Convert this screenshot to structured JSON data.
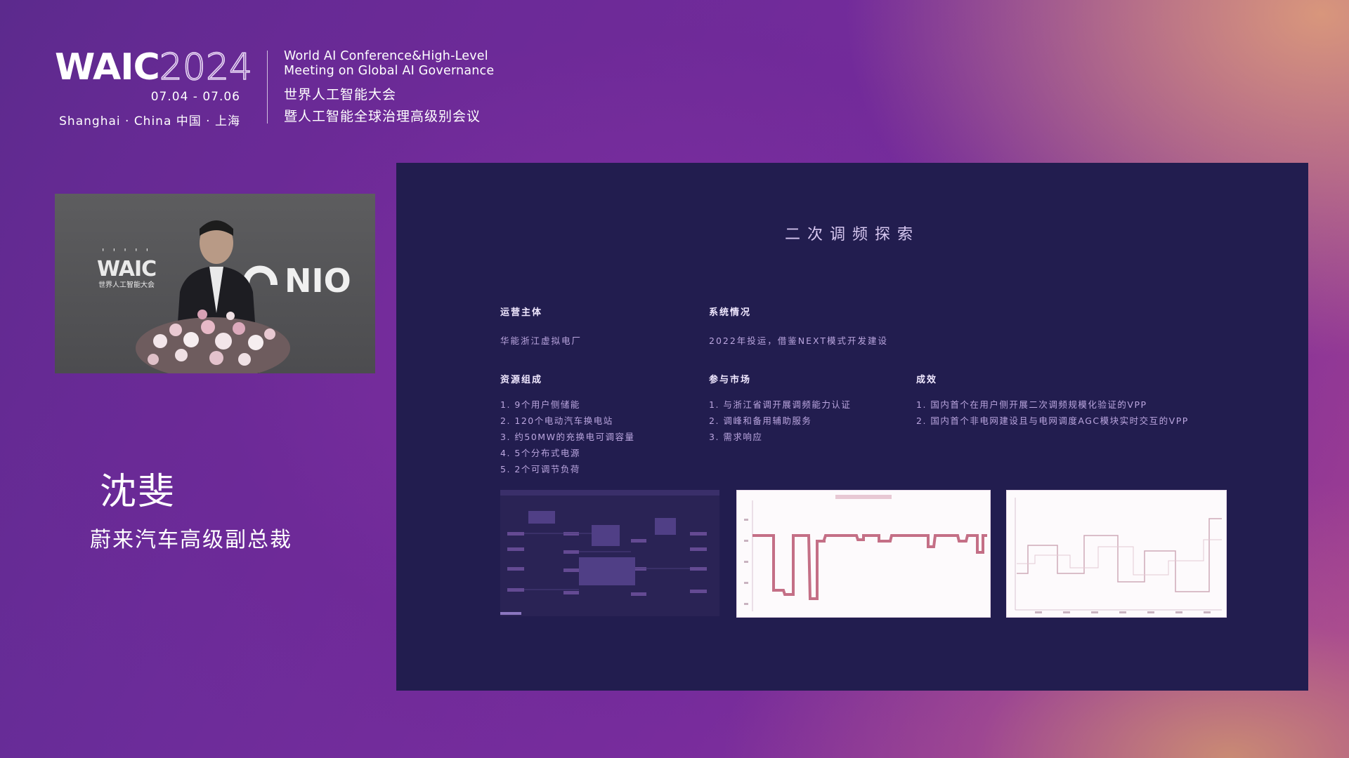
{
  "header": {
    "logo_word": "WAIC",
    "logo_year": "2024",
    "dates": "07.04 - 07.06",
    "location": "Shanghai · China  中国 · 上海",
    "title_en_line1": "World AI Conference&High-Level",
    "title_en_line2": "Meeting on Global AI Governance",
    "title_cn_line1": "世界人工智能大会",
    "title_cn_line2": "暨人工智能全球治理高级别会议"
  },
  "video": {
    "backdrop_logo_word": "WAIC",
    "backdrop_logo_sub": "世界人工智能大会",
    "backdrop_brand": "NIO"
  },
  "speaker": {
    "name": "沈斐",
    "title": "蔚来汽车高级副总裁"
  },
  "slide": {
    "title": "二次调频探索",
    "operator": {
      "heading": "运营主体",
      "body": "华能浙江虚拟电厂"
    },
    "system": {
      "heading": "系统情况",
      "body": "2022年投运，借鉴NEXT模式开发建设"
    },
    "resources": {
      "heading": "资源组成",
      "items": [
        "1. 9个用户侧储能",
        "2. 120个电动汽车换电站",
        "3. 约50MW的充换电可调容量",
        "4. 5个分布式电源",
        "5. 2个可调节负荷"
      ]
    },
    "markets": {
      "heading": "参与市场",
      "items": [
        "1. 与浙江省调开展调频能力认证",
        "2. 调峰和备用辅助服务",
        "3. 需求响应"
      ]
    },
    "results": {
      "heading": "成效",
      "items": [
        "1. 国内首个在用户侧开展二次调频规模化验证的VPP",
        "2. 国内首个非电网建设且与电网调度AGC模块实时交互的VPP"
      ]
    }
  },
  "colors": {
    "slide_bg": "#221d4f",
    "heading": "#f0e8ff",
    "body_text": "#bba6df",
    "chart_line": "#c46f86"
  }
}
